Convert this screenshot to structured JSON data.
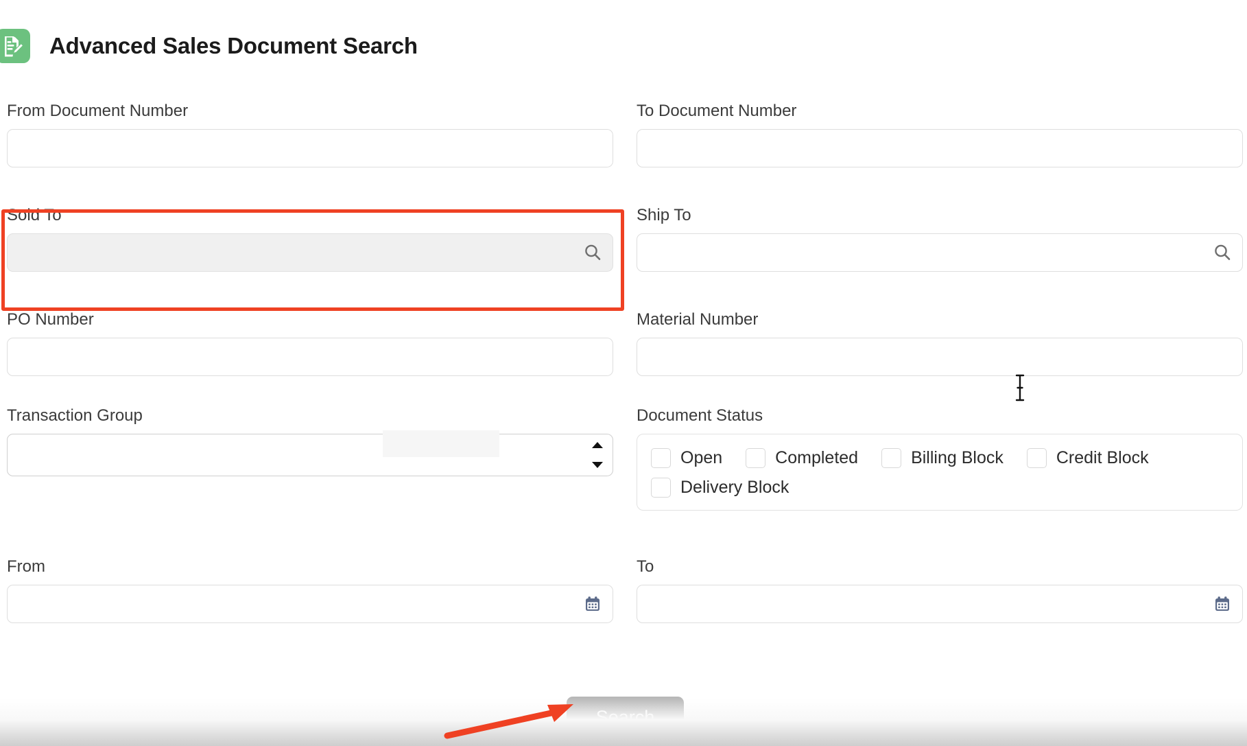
{
  "header": {
    "title": "Advanced Sales Document Search",
    "icon": "document-edit-icon",
    "icon_color": "#6cc17f"
  },
  "fields": {
    "from_document_number": {
      "label": "From Document Number",
      "value": "",
      "placeholder": ""
    },
    "to_document_number": {
      "label": "To Document Number",
      "value": "",
      "placeholder": ""
    },
    "sold_to": {
      "label": "Sold To",
      "value": "",
      "placeholder": "",
      "icon": "search-icon",
      "state": "focused"
    },
    "ship_to": {
      "label": "Ship To",
      "value": "",
      "placeholder": "",
      "icon": "search-icon",
      "state": "default"
    },
    "po_number": {
      "label": "PO Number",
      "value": "",
      "placeholder": ""
    },
    "material_number": {
      "label": "Material Number",
      "value": "",
      "placeholder": ""
    },
    "transaction_group": {
      "label": "Transaction Group",
      "selected": "",
      "options": [
        ""
      ]
    },
    "document_status": {
      "label": "Document Status",
      "rows": [
        [
          {
            "label": "Open",
            "checked": false
          },
          {
            "label": "Completed",
            "checked": false
          },
          {
            "label": "Billing Block",
            "checked": false
          },
          {
            "label": "Credit Block",
            "checked": false
          }
        ],
        [
          {
            "label": "Delivery Block",
            "checked": false
          }
        ]
      ]
    },
    "date_from": {
      "label": "From",
      "value": "",
      "placeholder": "",
      "icon": "calendar-icon"
    },
    "date_to": {
      "label": "To",
      "value": "",
      "placeholder": "",
      "icon": "calendar-icon"
    }
  },
  "actions": {
    "search_label": "Search"
  },
  "annotations": {
    "highlight_target": "sold-to-field",
    "highlight_color": "#ef4123",
    "arrow_color": "#ef4123",
    "arrow_target": "search-button"
  }
}
